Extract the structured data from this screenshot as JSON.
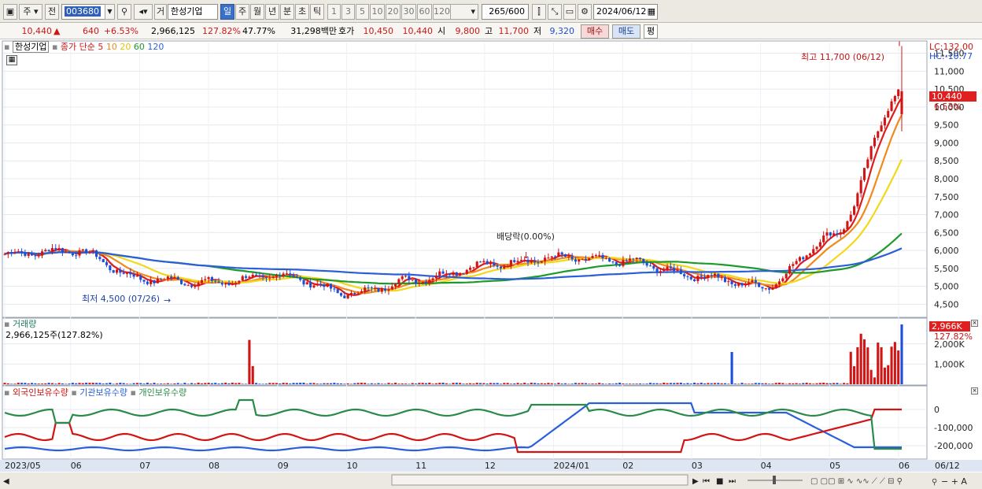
{
  "toolbar": {
    "type_label": "주",
    "prev_label": "전",
    "code_value": "003680",
    "mode_label": "거",
    "stock_name": "한성기업",
    "period_tabs": [
      {
        "label": "일",
        "selected": true
      },
      {
        "label": "주",
        "selected": false
      },
      {
        "label": "월",
        "selected": false
      },
      {
        "label": "년",
        "selected": false
      },
      {
        "label": "분",
        "selected": false
      },
      {
        "label": "초",
        "selected": false
      },
      {
        "label": "틱",
        "selected": false
      }
    ],
    "interval_tabs": [
      "1",
      "3",
      "5",
      "10",
      "20",
      "30",
      "60",
      "120"
    ],
    "count_value": "265",
    "count_max": "/600",
    "date_value": "2024/06/12"
  },
  "quote": {
    "price": "10,440",
    "change_arrow": "▲",
    "change": "640",
    "change_pct": "+6.53%",
    "volume": "2,966,125",
    "volume_ratio": "127.82%",
    "turnover_pct": "47.77%",
    "amount": "31,298백만",
    "bid_label": "호가",
    "bid": "10,450",
    "ask": "10,440",
    "open_label": "시",
    "open": "9,800",
    "high_label": "고",
    "high": "11,700",
    "low_label": "저",
    "low": "9,320",
    "buy_label": "매수",
    "sell_label": "매도",
    "eval_label": "평"
  },
  "price_panel": {
    "stock_tag": "한성기업",
    "ma_legend": {
      "prefix": "종가 단순",
      "periods": [
        {
          "label": "5",
          "color": "#e01b1b"
        },
        {
          "label": "10",
          "color": "#f08a1c"
        },
        {
          "label": "20",
          "color": "#f2d81a"
        },
        {
          "label": "60",
          "color": "#1e9a2c"
        },
        {
          "label": "120",
          "color": "#2b5fd9"
        }
      ]
    },
    "lc_label": "LC:132.00",
    "hc_label": "HC:-10.77",
    "last_price_label": "10,440",
    "last_pct_label": "6.53%",
    "high_annotation": "최고 11,700 (06/12)",
    "low_annotation": "최저 4,500 (07/26)",
    "dividend_annotation": "배당락(0.00%)",
    "y_ticks": [
      "11,500",
      "11,000",
      "10,500",
      "10,000",
      "9,500",
      "9,000",
      "8,500",
      "8,000",
      "7,500",
      "7,000",
      "6,500",
      "6,000",
      "5,500",
      "5,000",
      "4,500"
    ]
  },
  "volume_panel": {
    "title": "거래량",
    "info": "2,966,125주(127.82%)",
    "last_label": "2,966K",
    "last_pct": "127.82%",
    "y_ticks": [
      "2,000K",
      "1,000K"
    ]
  },
  "holdings_panel": {
    "legend": [
      {
        "label": "외국인보유수량",
        "color": "#d11414"
      },
      {
        "label": "기관보유수량",
        "color": "#2b5fd9"
      },
      {
        "label": "개인보유수량",
        "color": "#2a8a4a"
      }
    ],
    "y_ticks": [
      "0",
      "-100,000",
      "-200,000"
    ]
  },
  "x_axis": {
    "labels": [
      "2023/05",
      "06",
      "07",
      "08",
      "09",
      "10",
      "11",
      "12",
      "2024/01",
      "02",
      "03",
      "04",
      "05",
      "06"
    ],
    "end_label": "06/12"
  },
  "colors": {
    "up": "#d11414",
    "down": "#1d4fd8",
    "ma5": "#e01b1b",
    "ma10": "#f08a1c",
    "ma20": "#f2d81a",
    "ma60": "#1e9a2c",
    "ma120": "#2b5fd9"
  },
  "chart_data": {
    "type": "candlestick",
    "period": "daily",
    "y_range": [
      4200,
      11800
    ],
    "months": [
      {
        "label": "2023/05",
        "close": 5900
      },
      {
        "label": "06",
        "close": 6000
      },
      {
        "label": "07",
        "close": 5200
      },
      {
        "label": "08",
        "close": 5100
      },
      {
        "label": "09",
        "close": 5300
      },
      {
        "label": "10",
        "close": 4800
      },
      {
        "label": "11",
        "close": 5200
      },
      {
        "label": "12",
        "close": 5600
      },
      {
        "label": "2024/01",
        "close": 5800
      },
      {
        "label": "02",
        "close": 5700
      },
      {
        "label": "03",
        "close": 5300
      },
      {
        "label": "04",
        "close": 5000
      },
      {
        "label": "05",
        "close": 6400
      },
      {
        "label": "06/12",
        "close": 10440
      }
    ],
    "max": {
      "value": 11700,
      "date": "06/12"
    },
    "min": {
      "value": 4500,
      "date": "07/26"
    },
    "last": {
      "close": 10440,
      "open": 9800,
      "high": 11700,
      "low": 9320,
      "change": 640,
      "change_pct": 6.53
    }
  }
}
